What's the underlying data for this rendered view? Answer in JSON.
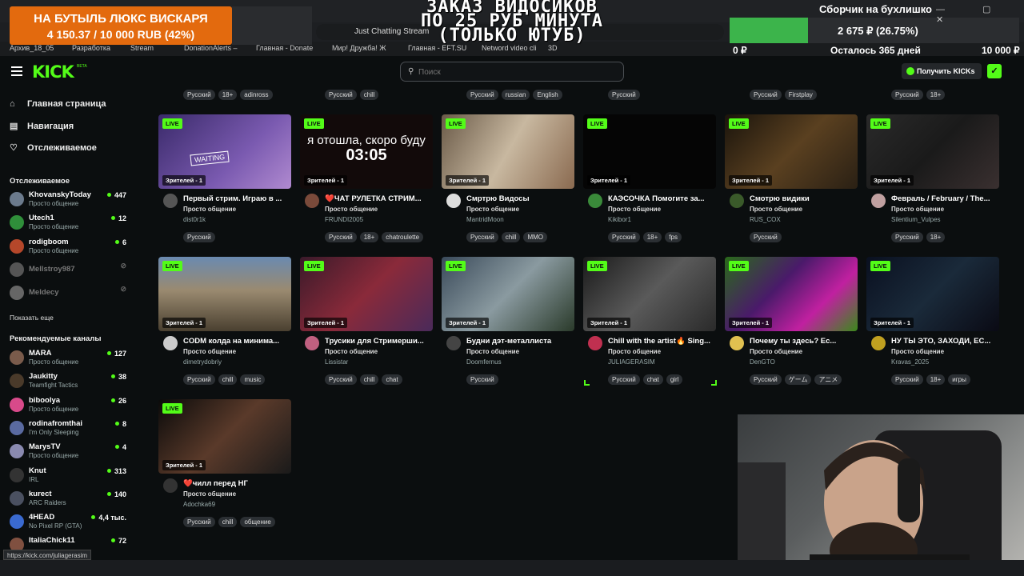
{
  "overlay": {
    "donation_goal": {
      "title": "НА БУТЫЛЬ ЛЮКС ВИСКАРЯ",
      "amount": "4 150.37 / 10 000 RUB (42%)"
    },
    "banner_lines": [
      "ЗАКАЗ ВИДОСИКОВ",
      "ПО 25 РУБ МИНУТА",
      "(ТОЛЬКО ЮТУБ)"
    ],
    "collection_goal": {
      "title": "Сборчик на бухлишко",
      "amount": "2 675 ₽ (26.75%)",
      "progress": 0.2675,
      "min": "0 ₽",
      "remaining": "Осталось 365 дней",
      "max": "10 000 ₽"
    }
  },
  "browser": {
    "window_controls": "— ▢ ✕",
    "url_text": "Just Chatting Stream",
    "bookmarks": [
      "Архив_18_05",
      "Разработка",
      "Stream",
      "DonationAlerts –",
      "Главная - Donate",
      "Мир! Дружба! Ж",
      "Главная - EFT.SU",
      "Netword video cli",
      "3D"
    ],
    "status_url": "https://kick.com/juliagerasim"
  },
  "header": {
    "logo": "KICK",
    "beta": "BETA",
    "search_placeholder": "Поиск",
    "get_kicks": "Получить KICKs"
  },
  "sidebar": {
    "nav": [
      {
        "icon": "home-icon",
        "glyph": "⌂",
        "label": "Главная страница"
      },
      {
        "icon": "browse-icon",
        "glyph": "▤",
        "label": "Навигация"
      },
      {
        "icon": "heart-icon",
        "glyph": "♡",
        "label": "Отслеживаемое"
      }
    ],
    "following_title": "Отслеживаемое",
    "following": [
      {
        "name": "KhovanskyToday",
        "category": "Просто общение",
        "viewers": "447",
        "color": "#6b7a8c"
      },
      {
        "name": "Utech1",
        "category": "Просто общение",
        "viewers": "12",
        "color": "#2f8f3a"
      },
      {
        "name": "rodigboom",
        "category": "Просто общение",
        "viewers": "6",
        "color": "#b5472a"
      },
      {
        "name": "Mellstroy987",
        "offline": true,
        "color": "#555"
      },
      {
        "name": "Meldecy",
        "offline": true,
        "color": "#666"
      }
    ],
    "show_more": "Показать еще",
    "recommended_title": "Рекомендуемые каналы",
    "recommended": [
      {
        "name": "MARA",
        "category": "Просто общение",
        "viewers": "127",
        "color": "#7a5b4b"
      },
      {
        "name": "Jaukitty",
        "category": "Teamfight Tactics",
        "viewers": "38",
        "color": "#4a3a2a"
      },
      {
        "name": "biboolya",
        "category": "Просто общение",
        "viewers": "26",
        "color": "#d84a8a"
      },
      {
        "name": "rodinafromthai",
        "category": "I'm Only Sleeping",
        "viewers": "8",
        "color": "#5a6aa0"
      },
      {
        "name": "MarysTV",
        "category": "Просто общение",
        "viewers": "4",
        "color": "#8a8ab0"
      },
      {
        "name": "Knut",
        "category": "IRL",
        "viewers": "313",
        "color": "#333"
      },
      {
        "name": "kurect",
        "category": "ARC Raiders",
        "viewers": "140",
        "color": "#4a5060"
      },
      {
        "name": "4HEAD",
        "category": "No Pixel RP (GTA)",
        "viewers": "4,4 тыс.",
        "color": "#3a6ad0"
      },
      {
        "name": "ItaliaChick11",
        "category": "",
        "viewers": "72",
        "color": "#805040"
      }
    ]
  },
  "top_tag_rows": [
    [
      "Русский",
      "18+",
      "adinross"
    ],
    [
      "Русский",
      "chill"
    ],
    [
      "Русский",
      "russian",
      "English"
    ],
    [
      "Русский"
    ],
    [
      "Русский",
      "Firstplay"
    ],
    [
      "Русский",
      "18+"
    ]
  ],
  "live_label": "LIVE",
  "cards": [
    {
      "title": "Первый стрим. Играю в ...",
      "category": "Просто общение",
      "user": "dist0r1k",
      "viewers": "Зрителей - 1",
      "tags": [
        "Русский"
      ],
      "bg": "linear-gradient(135deg,#3a2a6a,#7a5ab0 60%,#b08ad0)",
      "av": "#555",
      "overlay": "WAITING"
    },
    {
      "title": "❤️ЧАТ РУЛЕТКА СТРИМ...",
      "category": "Просто общение",
      "user": "FRUNDI2005",
      "viewers": "Зрителей - 1",
      "tags": [
        "Русский",
        "18+",
        "chatroulette"
      ],
      "bg": "#120a0a",
      "av": "#7a4a3a",
      "overlay": "я отошла, скоро буду|03:05"
    },
    {
      "title": "Смртрю Видосы",
      "category": "Просто общение",
      "user": "MantridMoon",
      "viewers": "Зрителей - 1",
      "tags": [
        "Русский",
        "chill",
        "MMO"
      ],
      "bg": "linear-gradient(120deg,#6a5a48,#c8b8a0 50%,#8a6a50)",
      "av": "#ddd",
      "overlay": ""
    },
    {
      "title": "КАЭСОЧКА Помогите за...",
      "category": "Просто общение",
      "user": "Kikibor1",
      "viewers": "Зрителей - 1",
      "tags": [
        "Русский",
        "18+",
        "fps"
      ],
      "bg": "#050505",
      "av": "#3a8a3a",
      "overlay": ""
    },
    {
      "title": "Смотрю видики",
      "category": "Просто общение",
      "user": "RUS_COX",
      "viewers": "Зрителей - 1",
      "tags": [
        "Русский"
      ],
      "bg": "linear-gradient(135deg,#1a140c,#5a4020 50%,#2a2014)",
      "av": "#3a5a2a",
      "overlay": ""
    },
    {
      "title": "Февраль / February / The...",
      "category": "Просто общение",
      "user": "Silentium_Vulpes",
      "viewers": "Зрителей - 1",
      "tags": [
        "Русский",
        "18+"
      ],
      "bg": "linear-gradient(135deg,#2a2a2a,#1a1a1a 50%,#3a3030)",
      "av": "#c0a0a0",
      "overlay": ""
    },
    {
      "title": "CODM колда на минима...",
      "category": "Просто общение",
      "user": "dimetrydobriy",
      "viewers": "Зрителей - 1",
      "tags": [
        "Русский",
        "chill",
        "music"
      ],
      "bg": "linear-gradient(180deg,#6a8ab0,#9a8a70 45%,#4a4030)",
      "av": "#ccc",
      "overlay": ""
    },
    {
      "title": "Трусики для Стримерши...",
      "category": "Просто общение",
      "user": "Lissistar",
      "viewers": "Зрителей - 1",
      "tags": [
        "Русский",
        "chill",
        "chat"
      ],
      "bg": "linear-gradient(135deg,#3a1a2a,#8a2a3a 50%,#4a2a5a)",
      "av": "#c06080",
      "overlay": ""
    },
    {
      "title": "Будни дэт-металлиста",
      "category": "Просто общение",
      "user": "Doomfernus",
      "viewers": "Зрителей - 1",
      "tags": [
        "Русский"
      ],
      "bg": "linear-gradient(135deg,#3a4a5a,#8a9aa0 50%,#2a3a2a)",
      "av": "#444",
      "overlay": ""
    },
    {
      "title": "Chill with the artist🔥 Sing...",
      "category": "Просто общение",
      "user": "JULIAGERASIM",
      "viewers": "Зрителей - 1",
      "tags": [
        "Русский",
        "chat",
        "girl"
      ],
      "bg": "linear-gradient(135deg,#1a1a1a,#5a5a5a 50%,#2a2a2a)",
      "av": "#c03050",
      "overlay": ""
    },
    {
      "title": "Почему ты здесь? Ес...",
      "category": "Просто общение",
      "user": "DenGTO",
      "viewers": "Зрителей - 1",
      "tags": [
        "Русский",
        "ゲーム",
        "アニメ"
      ],
      "bg": "linear-gradient(135deg,#2a6a1a,#4a1a6a 40%,#c020a0 70%,#3a8a1a)",
      "av": "#e0c050",
      "overlay": ""
    },
    {
      "title": "НУ ТЫ ЭТО, ЗАХОДИ, ЕС...",
      "category": "Просто общение",
      "user": "Kravas_2025",
      "viewers": "Зрителей - 1",
      "tags": [
        "Русский",
        "18+",
        "игры"
      ],
      "bg": "linear-gradient(135deg,#0a1020,#1a2a3a 50%,#0a0a14)",
      "av": "#c0a020",
      "overlay": ""
    },
    {
      "title": "❤️чилл перед НГ",
      "category": "Просто общение",
      "user": "Adochka69",
      "viewers": "Зрителей - 1",
      "tags": [
        "Русский",
        "chill",
        "общение"
      ],
      "bg": "linear-gradient(135deg,#0a0a0a,#5a3a2a 50%,#1a1a1a)",
      "av": "#333",
      "overlay": ""
    }
  ],
  "colors": {
    "accent": "#53fc18",
    "background": "#0b0e0f",
    "donation": "#e36a0e",
    "goal_fill": "#3cb44b"
  }
}
